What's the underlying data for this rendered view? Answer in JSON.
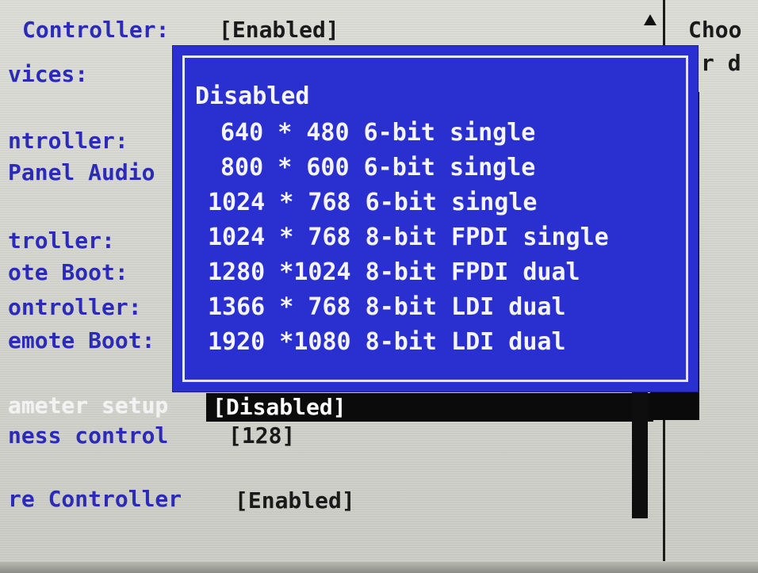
{
  "bios": {
    "left_labels": [
      "Controller:",
      "vices:",
      "ntroller:",
      "Panel Audio",
      "troller:",
      "ote Boot:",
      "ontroller:",
      "emote Boot:",
      "ameter setup",
      "ness control",
      "re Controller"
    ],
    "values": {
      "controller_status": "[Enabled]",
      "parameter_setup": "[Disabled]",
      "brightness": "[128]",
      "ware_controller": "[Enabled]"
    },
    "help_lines": [
      "Choo",
      "r d"
    ],
    "popup": {
      "title": "Disabled",
      "options": [
        "640 * 480 6-bit single",
        "800 * 600 6-bit single",
        "1024 * 768 6-bit single",
        "1024 * 768 8-bit FPDI single",
        "1280 *1024 8-bit FPDI dual",
        "1366 * 768 8-bit LDI dual",
        "1920 *1080 8-bit LDI dual"
      ]
    },
    "icons": {
      "scroll_up": "up-arrow-icon"
    },
    "colors": {
      "label_blue": "#2b2bb7",
      "popup_blue": "#2a2fd0",
      "selected_bg": "#0b0b0b"
    }
  }
}
